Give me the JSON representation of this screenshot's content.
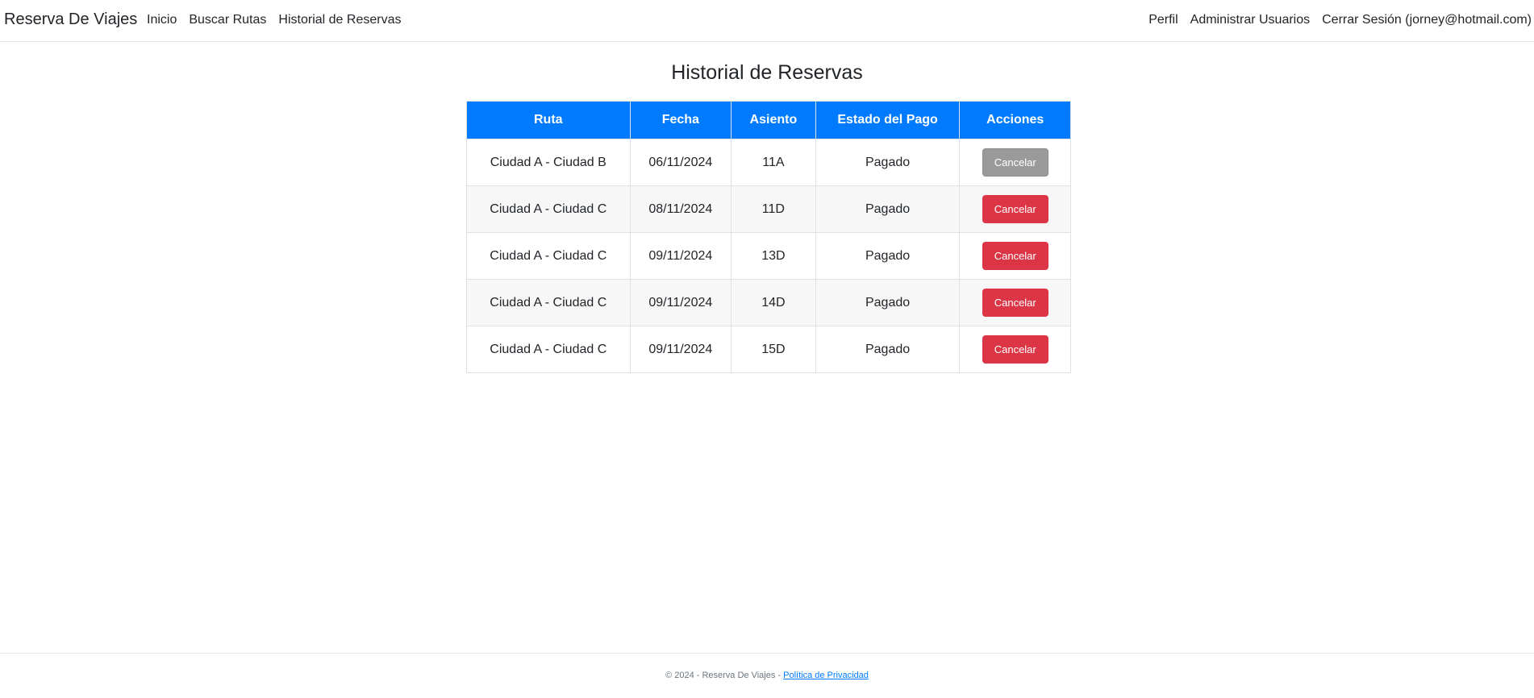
{
  "navbar": {
    "brand": "Reserva De Viajes",
    "left_links": [
      "Inicio",
      "Buscar Rutas",
      "Historial de Reservas"
    ],
    "right_links": [
      "Perfil",
      "Administrar Usuarios",
      "Cerrar Sesión (jorney@hotmail.com)"
    ]
  },
  "page": {
    "title": "Historial de Reservas"
  },
  "table": {
    "headers": [
      "Ruta",
      "Fecha",
      "Asiento",
      "Estado del Pago",
      "Acciones"
    ],
    "rows": [
      {
        "ruta": "Ciudad A - Ciudad B",
        "fecha": "06/11/2024",
        "asiento": "11A",
        "estado": "Pagado",
        "accion": "Cancelar",
        "accion_enabled": false
      },
      {
        "ruta": "Ciudad A - Ciudad C",
        "fecha": "08/11/2024",
        "asiento": "11D",
        "estado": "Pagado",
        "accion": "Cancelar",
        "accion_enabled": true
      },
      {
        "ruta": "Ciudad A - Ciudad C",
        "fecha": "09/11/2024",
        "asiento": "13D",
        "estado": "Pagado",
        "accion": "Cancelar",
        "accion_enabled": true
      },
      {
        "ruta": "Ciudad A - Ciudad C",
        "fecha": "09/11/2024",
        "asiento": "14D",
        "estado": "Pagado",
        "accion": "Cancelar",
        "accion_enabled": true
      },
      {
        "ruta": "Ciudad A - Ciudad C",
        "fecha": "09/11/2024",
        "asiento": "15D",
        "estado": "Pagado",
        "accion": "Cancelar",
        "accion_enabled": true
      }
    ]
  },
  "footer": {
    "text": "© 2024 - Reserva De Viajes - ",
    "link": "Política de Privacidad"
  },
  "colors": {
    "header_bg": "#007bff",
    "cancel_button": "#dc3545",
    "cancel_button_disabled": "#9a9a9a",
    "link": "#007bff"
  }
}
